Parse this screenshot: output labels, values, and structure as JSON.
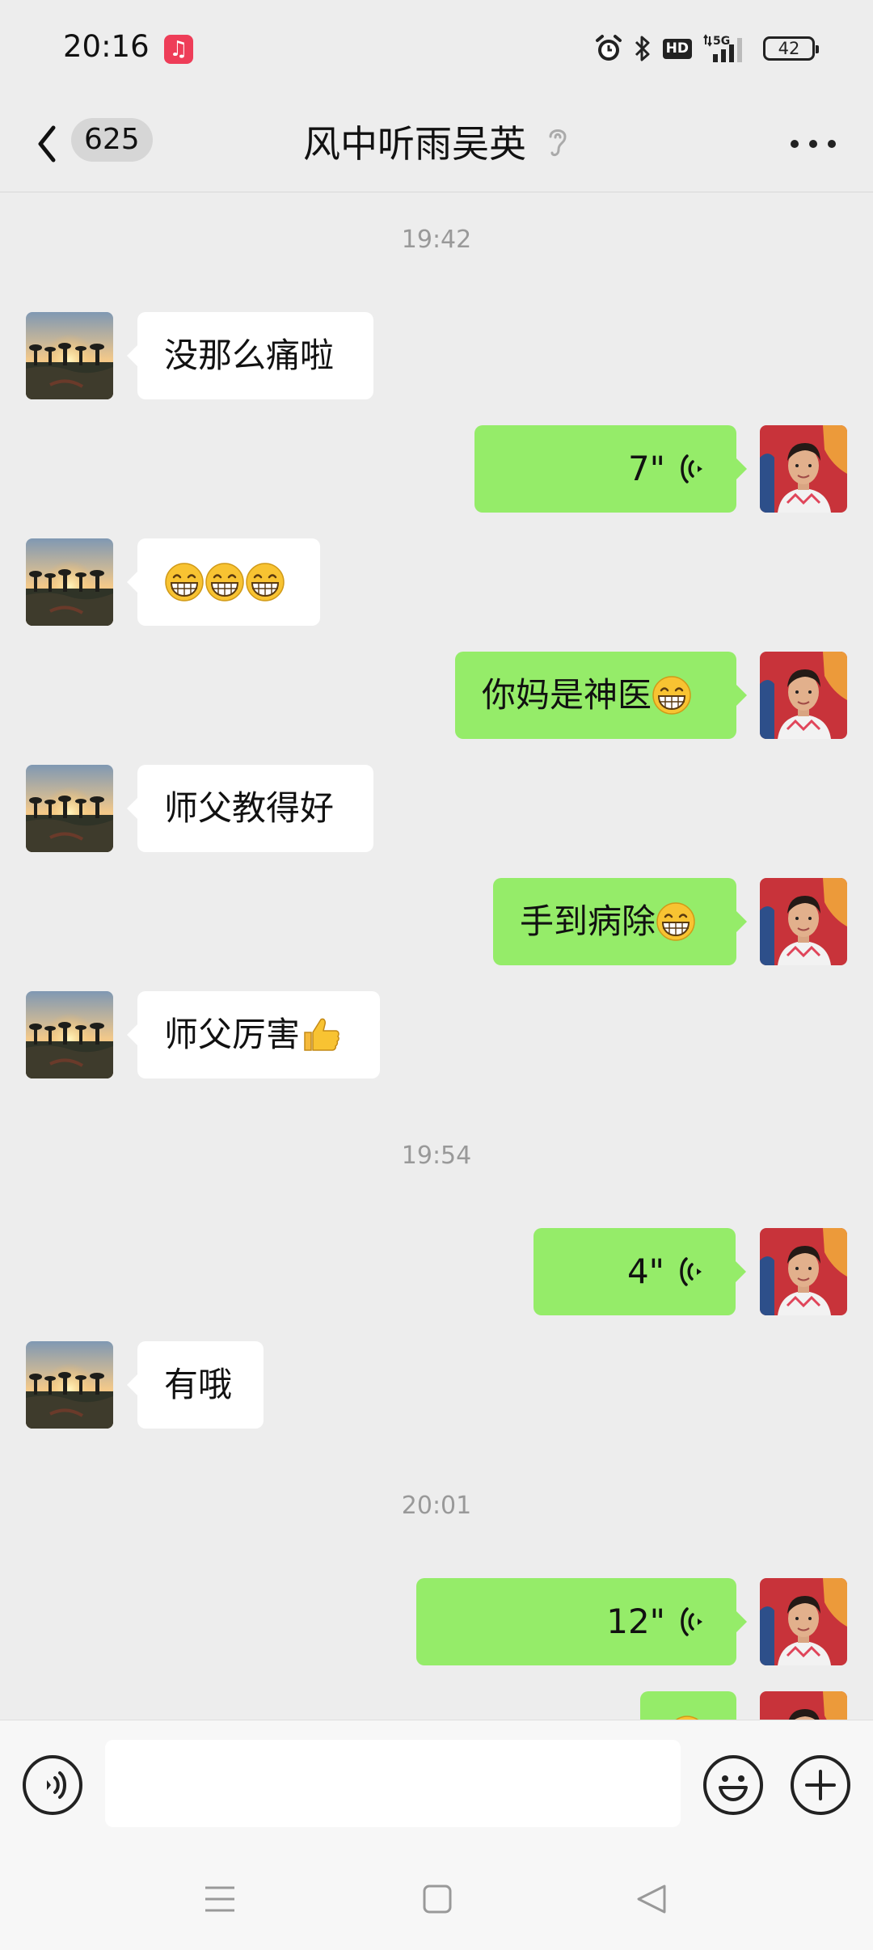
{
  "status_bar": {
    "time": "20:16",
    "network": "5G",
    "hd": "HD",
    "battery": "42",
    "icons": [
      "music-app-icon",
      "alarm-icon",
      "bluetooth-icon",
      "hd-icon",
      "signal-icon",
      "battery-icon"
    ]
  },
  "header": {
    "unread_count": "625",
    "title": "风中听雨吴英"
  },
  "messages": [
    {
      "type": "time",
      "text": "19:42"
    },
    {
      "type": "text",
      "side": "in",
      "text": "没那么痛啦"
    },
    {
      "type": "voice",
      "side": "out",
      "duration": "7\""
    },
    {
      "type": "text",
      "side": "in",
      "text": "",
      "emoji": [
        "grin",
        "grin",
        "grin"
      ]
    },
    {
      "type": "text",
      "side": "out",
      "text": "你妈是神医",
      "emoji": [
        "grin"
      ]
    },
    {
      "type": "text",
      "side": "in",
      "text": "师父教得好"
    },
    {
      "type": "text",
      "side": "out",
      "text": "手到病除",
      "emoji": [
        "grin"
      ]
    },
    {
      "type": "text",
      "side": "in",
      "text": "师父厉害",
      "emoji": [
        "thumbs-up"
      ]
    },
    {
      "type": "time",
      "text": "19:54"
    },
    {
      "type": "voice",
      "side": "out",
      "duration": "4\""
    },
    {
      "type": "text",
      "side": "in",
      "text": "有哦"
    },
    {
      "type": "time",
      "text": "20:01"
    },
    {
      "type": "voice",
      "side": "out",
      "duration": "12\""
    }
  ],
  "input": {
    "placeholder": ""
  },
  "colors": {
    "background": "#ededed",
    "outgoing_bubble": "#95ec69",
    "incoming_bubble": "#ffffff",
    "timestamp": "#999999"
  }
}
